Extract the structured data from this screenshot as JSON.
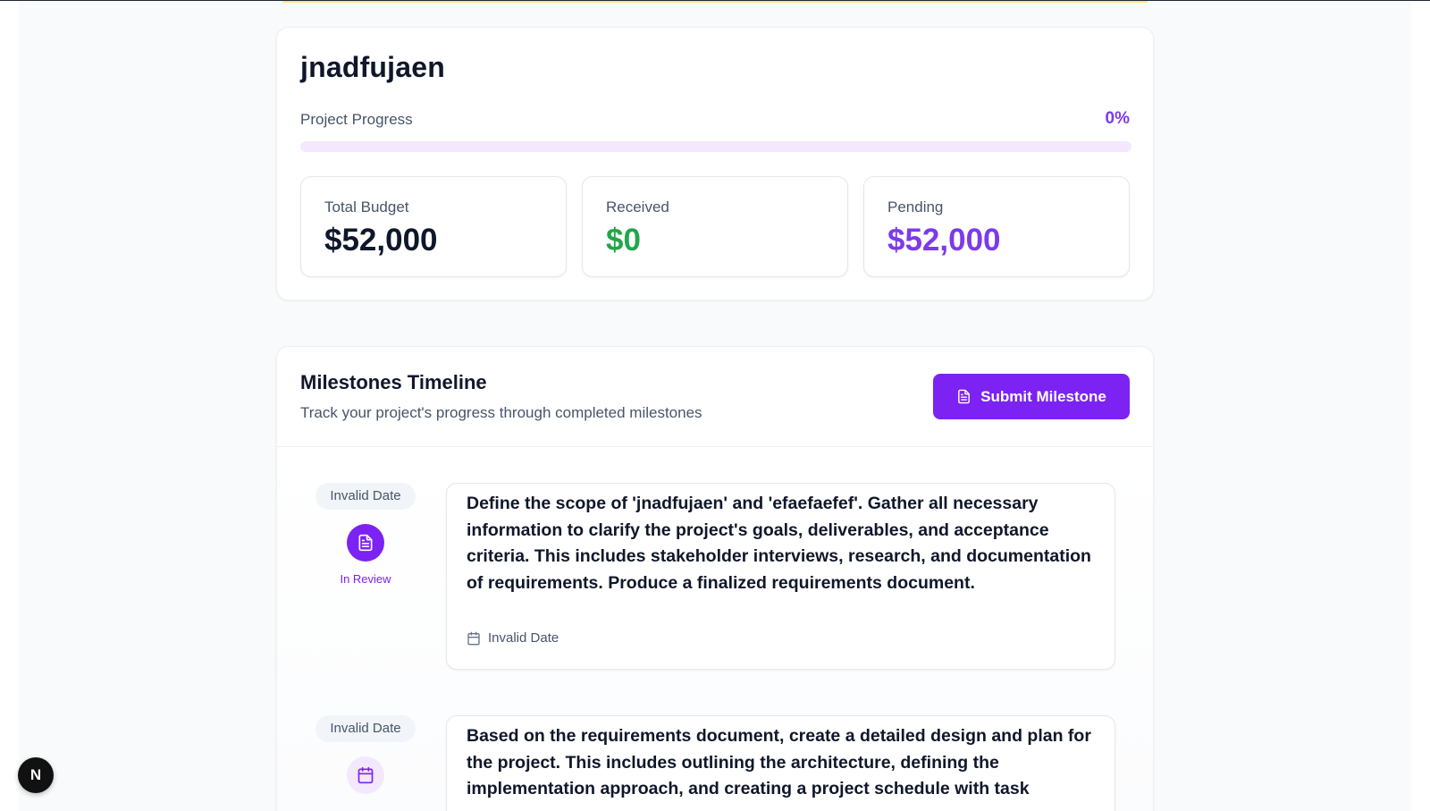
{
  "project": {
    "title": "jnadfujaen",
    "progress_label": "Project Progress",
    "progress_text": "0%",
    "progress_fraction": 0
  },
  "stats": {
    "budget": {
      "label": "Total Budget",
      "value": "$52,000"
    },
    "received": {
      "label": "Received",
      "value": "$0"
    },
    "pending": {
      "label": "Pending",
      "value": "$52,000"
    }
  },
  "milestones_section": {
    "title": "Milestones Timeline",
    "subtitle": "Track your project's progress through completed milestones",
    "submit_label": "Submit Milestone",
    "items": [
      {
        "date": "Invalid Date",
        "status": "In Review",
        "icon": "file-text-icon",
        "description": "Define the scope of 'jnadfujaen' and 'efaefaefef'. Gather all necessary information to clarify the project's goals, deliverables, and acceptance criteria. This includes stakeholder interviews, research, and documentation of requirements. Produce a finalized requirements document.",
        "due_date": "Invalid Date"
      },
      {
        "date": "Invalid Date",
        "status": "",
        "icon": "calendar-icon",
        "description": "Based on the requirements document, create a detailed design and plan for the project. This includes outlining the architecture, defining the implementation approach, and creating a project schedule with task",
        "due_date": ""
      }
    ]
  },
  "dev_indicator": {
    "letter": "N"
  },
  "colors": {
    "accent": "#7c22f2",
    "success": "#22a64a",
    "text_primary": "#0f172a",
    "text_secondary": "#475569"
  }
}
